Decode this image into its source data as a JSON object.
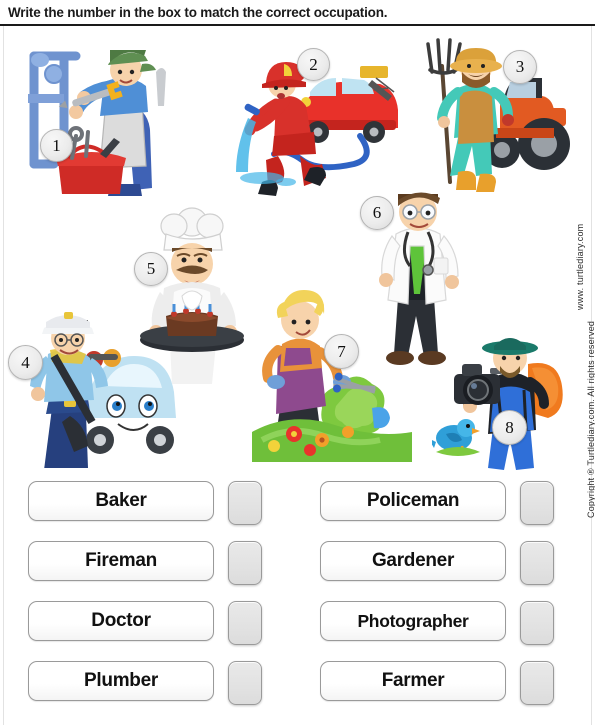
{
  "page": {
    "title": "Write the number in the box to match the correct occupation.",
    "copyright": "Copyright ® Turtlediary.com. All rights reserved",
    "website": "www. turtlediary.com",
    "background_color": "#ffffff",
    "rule_color": "#1a1a1a"
  },
  "illustrations": [
    {
      "number": "1",
      "occupation": "Plumber",
      "alt": "plumber-fixing-pipes-with-wrench-and-red-toolbag"
    },
    {
      "number": "2",
      "occupation": "Fireman",
      "alt": "fireman-spraying-hose-beside-red-fire-truck"
    },
    {
      "number": "3",
      "occupation": "Farmer",
      "alt": "farmer-with-pitchfork-and-sack-beside-red-tractor"
    },
    {
      "number": "4",
      "occupation": "Policeman",
      "alt": "policeman-in-blue-uniform-beside-police-car"
    },
    {
      "number": "5",
      "occupation": "Baker",
      "alt": "baker-in-chef-hat-holding-tray-with-cake"
    },
    {
      "number": "6",
      "occupation": "Doctor",
      "alt": "doctor-in-white-coat-with-stethoscope-and-green-tie"
    },
    {
      "number": "7",
      "occupation": "Gardener",
      "alt": "gardener-trimming-bush-with-shears-in-flower-garden"
    },
    {
      "number": "8",
      "occupation": "Photographer",
      "alt": "photographer-with-camera-and-orange-backpack-shooting-bird"
    }
  ],
  "answer_columns": {
    "left": [
      {
        "label": "Baker",
        "answer": ""
      },
      {
        "label": "Fireman",
        "answer": ""
      },
      {
        "label": "Doctor",
        "answer": ""
      },
      {
        "label": "Plumber",
        "answer": ""
      }
    ],
    "right": [
      {
        "label": "Policeman",
        "answer": ""
      },
      {
        "label": "Gardener",
        "answer": ""
      },
      {
        "label": "Photographer",
        "answer": ""
      },
      {
        "label": "Farmer",
        "answer": ""
      }
    ]
  }
}
